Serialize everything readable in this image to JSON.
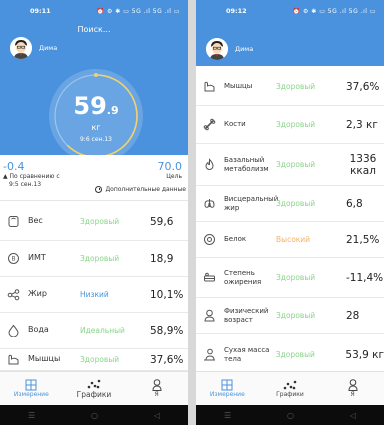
{
  "left": {
    "status": {
      "time": "09:11",
      "icons": "⏰ ⚙ ✱ ▭ 5G .ıl 5G .ıl ▭"
    },
    "search_label": "Поиск...",
    "user_name": "Дима",
    "gauge": {
      "value_int": "59",
      "value_dec": ".9",
      "unit": "кг",
      "date": "9:6 сен.13",
      "progress": 0.62
    },
    "compare": {
      "value": "-0.4",
      "label_line1": "▲ По сравнению с",
      "label_line2": "9:5 сен.13"
    },
    "goal": {
      "value": "70.0",
      "label": "Цель"
    },
    "more_data_label": "Дополнительные данные",
    "rows": [
      {
        "icon": "scale-icon",
        "name": "Вес",
        "status": "Здоровый",
        "status_color": "green",
        "value": "59,6"
      },
      {
        "icon": "bmi-icon",
        "name": "ИМТ",
        "status": "Здоровый",
        "status_color": "green",
        "value": "18,9"
      },
      {
        "icon": "fat-icon",
        "name": "Жир",
        "status": "Низкий",
        "status_color": "blue",
        "value": "10,1%"
      },
      {
        "icon": "water-icon",
        "name": "Вода",
        "status": "Идеальный",
        "status_color": "green",
        "value": "58,9%"
      },
      {
        "icon": "muscle-icon",
        "name": "Мышцы",
        "status": "Здоровый",
        "status_color": "green",
        "value": "37,6%"
      }
    ],
    "nav": [
      {
        "label": "Измерение",
        "icon": "grid-icon",
        "active": true
      },
      {
        "label": "Графики",
        "icon": "chart-dots-icon",
        "active": false
      },
      {
        "label": "Я",
        "icon": "person-icon",
        "active": false
      }
    ],
    "syskeys": [
      "☰",
      "○",
      "◁"
    ]
  },
  "right": {
    "status": {
      "time": "09:12",
      "icons": "⏰ ⚙ ✱ ▭ 5G .ıl 5G .ıl ▭"
    },
    "user_name": "Дима",
    "rows": [
      {
        "icon": "muscle-icon",
        "name": "Мышцы",
        "status": "Здоровый",
        "status_color": "green",
        "value": "37,6%"
      },
      {
        "icon": "bone-icon",
        "name": "Кости",
        "status": "Здоровый",
        "status_color": "green",
        "value": "2,3 кг"
      },
      {
        "icon": "metabolism-icon",
        "name": "Базальный метаболизм",
        "status": "Здоровый",
        "status_color": "green",
        "value": "1336 ккал"
      },
      {
        "icon": "visceral-fat-icon",
        "name": "Висцеральный жир",
        "status": "Здоровый",
        "status_color": "green",
        "value": "6,8"
      },
      {
        "icon": "protein-icon",
        "name": "Белок",
        "status": "Высокий",
        "status_color": "orange",
        "value": "21,5%"
      },
      {
        "icon": "obesity-icon",
        "name": "Степень ожирения",
        "status": "Здоровый",
        "status_color": "green",
        "value": "-11,4%"
      },
      {
        "icon": "body-age-icon",
        "name": "Физический возраст",
        "status": "Здоровый",
        "status_color": "green",
        "value": "28"
      },
      {
        "icon": "lean-mass-icon",
        "name": "Сухая масса тела",
        "status": "Здоровый",
        "status_color": "green",
        "value": "53,9 кг"
      }
    ],
    "nav": [
      {
        "label": "Измерение",
        "icon": "grid-icon",
        "active": true
      },
      {
        "label": "Графики",
        "icon": "chart-dots-icon",
        "active": false
      },
      {
        "label": "Я",
        "icon": "person-icon",
        "active": false
      }
    ],
    "syskeys": [
      "☰",
      "○",
      "◁"
    ]
  },
  "colors": {
    "brand_blue": "#4a92dd",
    "healthy_green": "#8bd48b",
    "high_orange": "#f1b36a",
    "gauge_yellow": "#f3d16b"
  }
}
